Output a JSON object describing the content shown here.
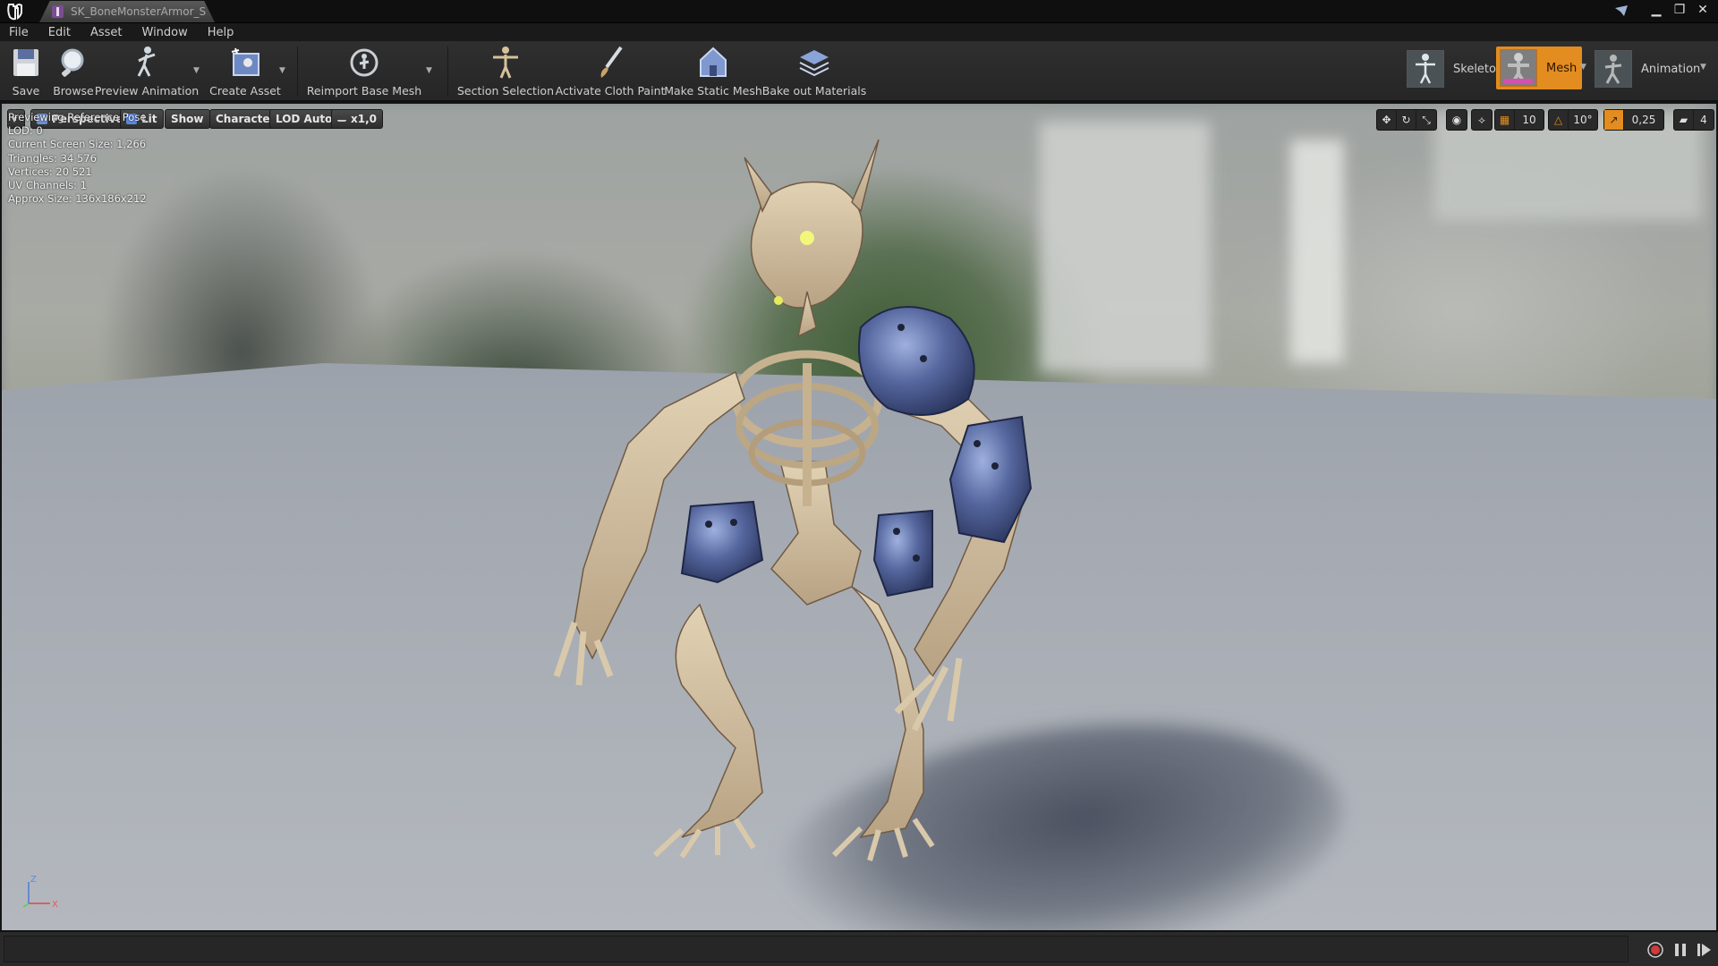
{
  "window": {
    "tab_title": "SK_BoneMonsterArmor_S"
  },
  "menu": [
    "File",
    "Edit",
    "Asset",
    "Window",
    "Help"
  ],
  "toolbar": {
    "save": "Save",
    "browse": "Browse",
    "preview_animation": "Preview Animation",
    "create_asset": "Create Asset",
    "reimport": "Reimport Base Mesh",
    "section_selection": "Section Selection",
    "cloth_paint": "Activate Cloth Paint",
    "static_mesh": "Make Static Mesh",
    "bake_materials": "Bake out Materials"
  },
  "modes": {
    "skeleton": "Skeleton",
    "mesh": "Mesh",
    "animation": "Animation"
  },
  "viewport_toolbar": {
    "perspective": "Perspective",
    "lit": "Lit",
    "show": "Show",
    "character": "Character",
    "lod": "LOD Auto",
    "speed": "x1,0",
    "grid_snap": "10",
    "rot_snap": "10°",
    "scale_snap": "0,25",
    "cam_speed": "4"
  },
  "stats": [
    "Previewing Reference Pose",
    "LOD: 0",
    "Current Screen Size: 1,266",
    "Triangles: 34 576",
    "Vertices: 20 521",
    "UV Channels: 1",
    "Approx Size: 136x186x212"
  ],
  "axis": {
    "z": "Z",
    "x": "X"
  },
  "colors": {
    "accent_orange": "#e38c1f",
    "armor_blue": "#4b5e9c",
    "bone": "#d8c6a6"
  }
}
